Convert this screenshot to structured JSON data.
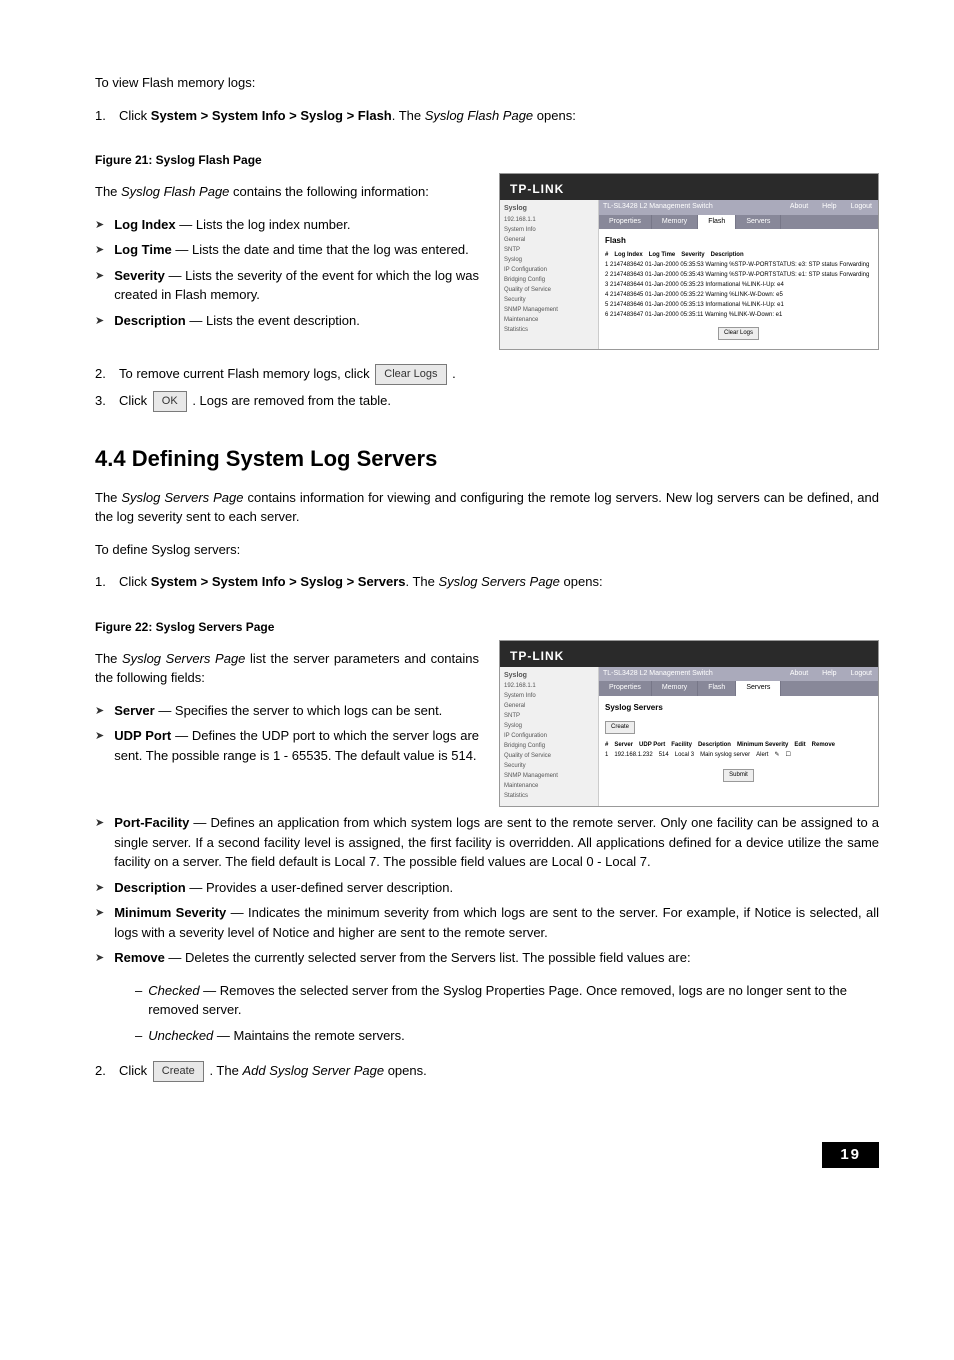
{
  "intro_flash": "To view Flash memory logs:",
  "step_flash_1_prefix": "Click ",
  "step_flash_1_bold": "System > System Info > Syslog > Flash",
  "step_flash_1_mid": ". The ",
  "step_flash_1_em": "Syslog Flash Page",
  "step_flash_1_suffix": " opens:",
  "fig21_caption": "Figure 21: Syslog Flash Page",
  "flash_desc_prefix": "The ",
  "flash_desc_em": "Syslog Flash Page",
  "flash_desc_suffix": " contains the following information:",
  "flash_bullets": [
    {
      "term": "Log Index",
      "text": " — Lists the log index number."
    },
    {
      "term": "Log Time",
      "text": " — Lists the date and time that the log was entered."
    },
    {
      "term": "Severity",
      "text": " — Lists the severity of the event for which the log was created in Flash memory."
    },
    {
      "term": "Description",
      "text": " — Lists the event description."
    }
  ],
  "step_flash_2_prefix": "To remove current Flash memory logs, click ",
  "btn_clear_logs": "Clear Logs",
  "step_flash_2_suffix": ".",
  "step_flash_3_prefix": "Click ",
  "btn_ok": "OK",
  "step_flash_3_suffix": ". Logs are removed from the table.",
  "section_4_4": "4.4  Defining System Log Servers",
  "servers_intro_prefix": "The ",
  "servers_intro_em": "Syslog Servers Page",
  "servers_intro_suffix": " contains information for viewing and configuring the remote log servers. New log servers can be defined, and the log severity sent to each server.",
  "servers_define": "To define Syslog servers:",
  "step_servers_1_prefix": "Click ",
  "step_servers_1_bold": "System > System Info > Syslog > Servers",
  "step_servers_1_mid": ". The ",
  "step_servers_1_em": "Syslog Servers Page",
  "step_servers_1_suffix": " opens:",
  "fig22_caption": "Figure 22: Syslog Servers Page",
  "servers_desc_prefix": "The ",
  "servers_desc_em": "Syslog Servers Page",
  "servers_desc_suffix": " list the server parameters and contains the following fields:",
  "servers_bullets_left": [
    {
      "term": "Server",
      "text": " — Specifies the server to which logs can be sent."
    },
    {
      "term": "UDP Port",
      "text": " — Defines the UDP port to which the server logs are sent. The possible range is 1 - 65535. The default value is 514."
    }
  ],
  "servers_bullets_full": [
    {
      "term": "Port-Facility",
      "text": " — Defines an application from which system logs are sent to the remote server. Only one facility can be assigned to a single server. If a second facility level is assigned, the first facility is overridden. All applications defined for a device utilize the same facility on a server. The field default is Local 7. The possible field values are Local 0 - Local 7."
    },
    {
      "term": "Description",
      "text": " — Provides a user-defined server description."
    },
    {
      "term": "Minimum Severity",
      "text": " — Indicates the minimum severity from which logs are sent to the server. For example, if Notice is selected, all logs with a severity level of Notice and higher are sent to the remote server."
    },
    {
      "term": "Remove",
      "text": " — Deletes the currently selected server from the Servers list. The possible field values are:"
    }
  ],
  "remove_sub": [
    {
      "term": "Checked",
      "text": " — Removes the selected server from the Syslog Properties Page. Once removed, logs are no longer sent to the removed server."
    },
    {
      "term": "Unchecked",
      "text": " — Maintains the remote servers."
    }
  ],
  "step_servers_2_prefix": "Click ",
  "btn_create": "Create",
  "step_servers_2_mid": ". The ",
  "step_servers_2_em": "Add Syslog Server Page",
  "step_servers_2_suffix": " opens.",
  "page_number": "19",
  "sc": {
    "brand": "TP-LINK",
    "model": "TL-SL3428 L2 Management Switch",
    "about": "About",
    "help": "Help",
    "logout": "Logout",
    "tabs": [
      "Properties",
      "Memory",
      "Flash",
      "Servers"
    ],
    "sidebar_title": "Syslog",
    "ip": "192.168.1.1",
    "tree": [
      "System Info",
      "  General",
      "  SNTP",
      "  Syslog",
      "IP Configuration",
      "Bridging Config",
      "Quality of Service",
      "Security",
      "SNMP Management",
      "Maintenance",
      "Statistics"
    ],
    "flash_heading": "Flash",
    "flash_cols": [
      "#",
      "Log Index",
      "Log Time",
      "Severity",
      "Description"
    ],
    "submit": "Submit",
    "clear_logs": "Clear Logs",
    "servers_heading": "Syslog Servers",
    "create": "Create",
    "servers_cols": [
      "#",
      "Server",
      "UDP Port",
      "Facility",
      "Description",
      "Minimum Severity",
      "Edit",
      "Remove"
    ],
    "server_row": [
      "1",
      "192.168.1.232",
      "514",
      "Local 3",
      "Main syslog server",
      "Alert"
    ]
  }
}
